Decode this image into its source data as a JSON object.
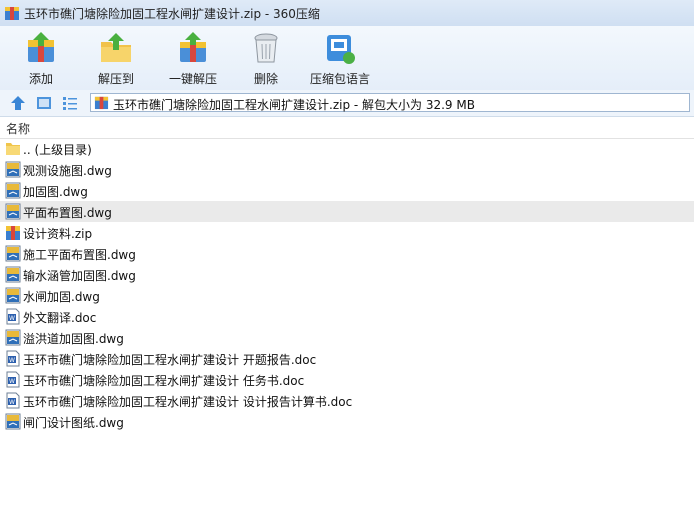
{
  "window": {
    "title": "玉环市礁门塘除险加固工程水闸扩建设计.zip - 360压缩"
  },
  "toolbar": {
    "add": "添加",
    "extract_to": "解压到",
    "one_click_extract": "一键解压",
    "delete": "删除",
    "archive_language": "压缩包语言"
  },
  "address": {
    "text": "玉环市礁门塘除险加固工程水闸扩建设计.zip - 解包大小为 32.9 MB"
  },
  "list": {
    "column_name": "名称",
    "files": [
      {
        "name": ".. (上级目录)",
        "icon": "folder-icon"
      },
      {
        "name": "观测设施图.dwg",
        "icon": "dwg-file-icon"
      },
      {
        "name": "加固图.dwg",
        "icon": "dwg-file-icon"
      },
      {
        "name": "平面布置图.dwg",
        "icon": "dwg-file-icon"
      },
      {
        "name": "设计资料.zip",
        "icon": "zip-file-icon"
      },
      {
        "name": "施工平面布置图.dwg",
        "icon": "dwg-file-icon"
      },
      {
        "name": "输水涵管加固图.dwg",
        "icon": "dwg-file-icon"
      },
      {
        "name": "水闸加固.dwg",
        "icon": "dwg-file-icon"
      },
      {
        "name": "外文翻译.doc",
        "icon": "doc-file-icon"
      },
      {
        "name": "溢洪道加固图.dwg",
        "icon": "dwg-file-icon"
      },
      {
        "name": "玉环市礁门塘除险加固工程水闸扩建设计 开题报告.doc",
        "icon": "doc-file-icon"
      },
      {
        "name": "玉环市礁门塘除险加固工程水闸扩建设计 任务书.doc",
        "icon": "doc-file-icon"
      },
      {
        "name": "玉环市礁门塘除险加固工程水闸扩建设计 设计报告计算书.doc",
        "icon": "doc-file-icon"
      },
      {
        "name": "闸门设计图纸.dwg",
        "icon": "dwg-file-icon"
      }
    ]
  }
}
